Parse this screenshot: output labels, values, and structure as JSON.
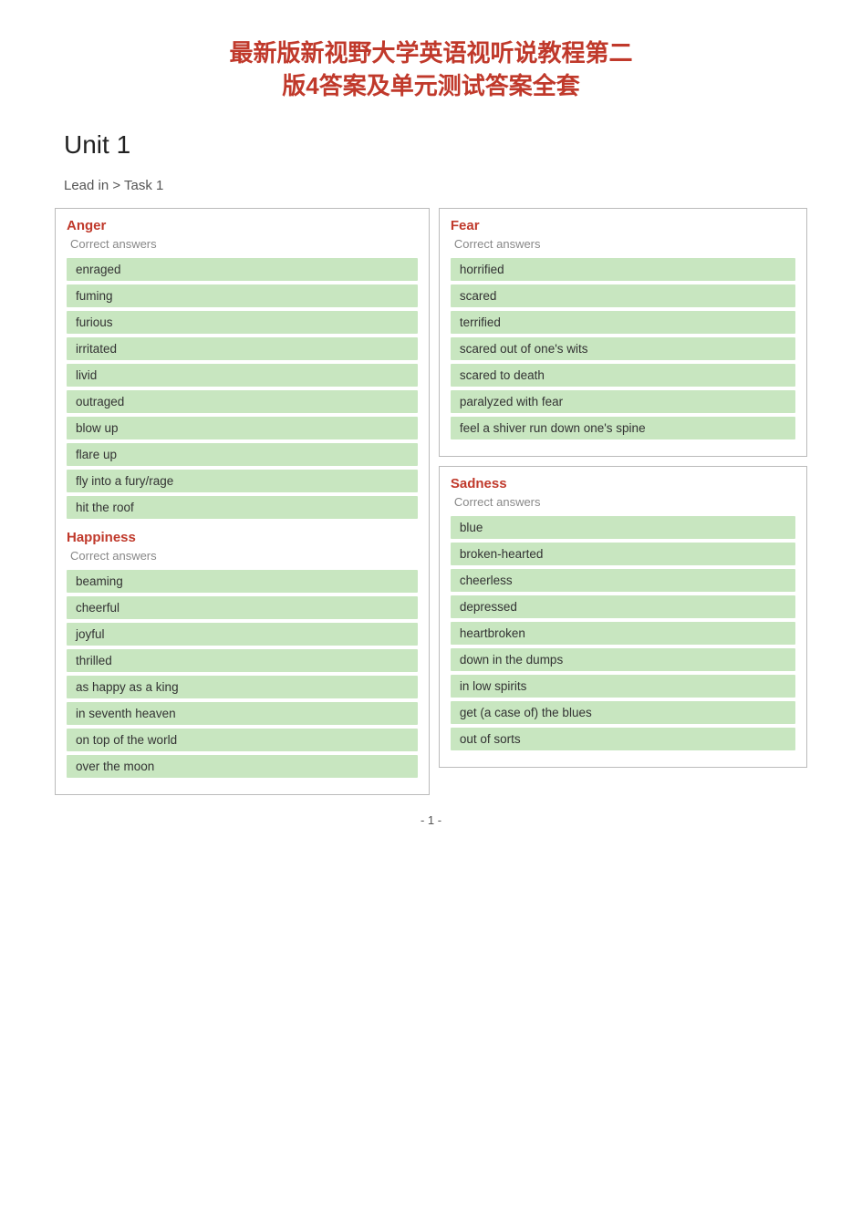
{
  "page": {
    "title_line1": "最新版新视野大学英语视听说教程第二",
    "title_line2": "版4答案及单元测试答案全套",
    "unit": "Unit  1",
    "lead_in": "Lead in > Task 1",
    "page_number": "- 1 -"
  },
  "anger": {
    "category": "Anger",
    "correct_answers_label": "Correct answers",
    "items": [
      "enraged",
      "fuming",
      "furious",
      "irritated",
      "livid",
      "outraged",
      "blow up",
      "flare up",
      "fly into a fury/rage",
      "hit the roof"
    ]
  },
  "happiness": {
    "category": "Happiness",
    "correct_answers_label": "Correct answers",
    "items": [
      "beaming",
      "cheerful",
      "joyful",
      "thrilled",
      "as happy as a king",
      "in seventh heaven",
      "on top of the world",
      "over the moon"
    ]
  },
  "fear": {
    "category": "Fear",
    "correct_answers_label": "Correct answers",
    "items": [
      "horrified",
      "scared",
      "terrified",
      "scared out of one's wits",
      "scared to death",
      "paralyzed with fear",
      "feel a shiver run down one's spine"
    ]
  },
  "sadness": {
    "category": "Sadness",
    "correct_answers_label": "Correct answers",
    "items": [
      "blue",
      "broken-hearted",
      "cheerless",
      "depressed",
      "heartbroken",
      "down in the dumps",
      "in low spirits",
      "get (a case of) the blues",
      "out of sorts"
    ]
  }
}
